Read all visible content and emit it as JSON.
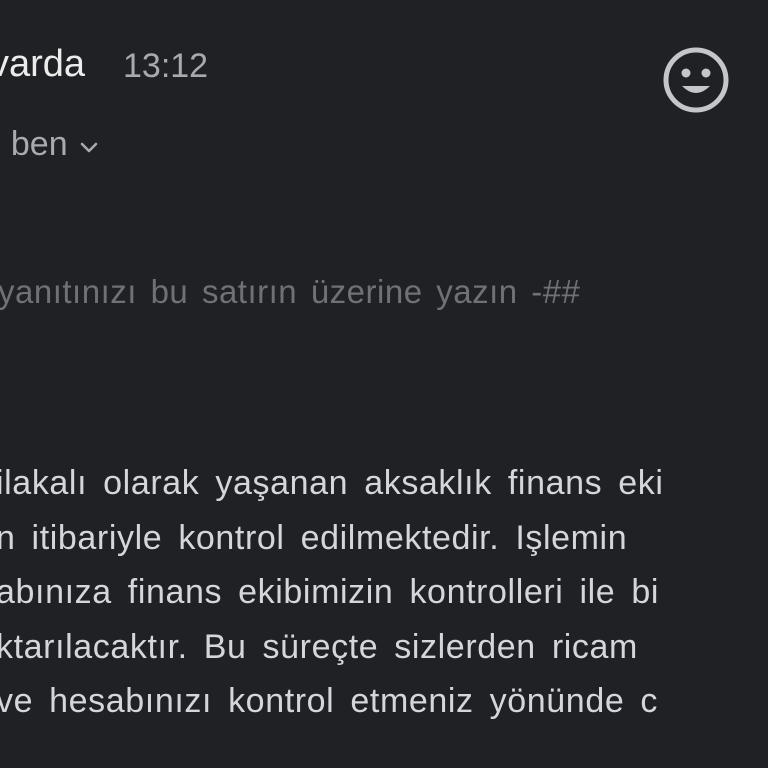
{
  "message": {
    "sender_partial": "varda",
    "time": "13:12",
    "recipient_partial": ": ben",
    "reply_marker": "yanıtınızı bu satırın üzerine yazın -##",
    "body_lines": [
      "ilakalı olarak yaşanan aksaklık finans eki",
      "n itibariyle kontrol edilmektedir. Işlemin",
      "abınıza finans ekibimizin kontrolleri ile bi",
      "ktarılacaktır. Bu süreçte sizlerden ricam",
      "ve hesabınızı kontrol etmeniz yönünde c"
    ]
  },
  "icons": {
    "emoji": "smiley-face-icon",
    "recipient_toggle": "chevron-down-icon"
  },
  "colors": {
    "background": "#202124",
    "sender_text": "#ececec",
    "secondary_text": "#a8aaad",
    "reply_marker_text": "#6f7175",
    "body_text": "#d4d6d9"
  }
}
